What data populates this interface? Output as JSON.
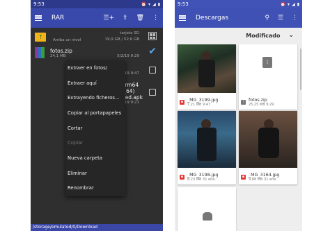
{
  "left": {
    "status_time": "9:53",
    "title": "RAR",
    "parent_row": {
      "label": "Arriba un nivel",
      "storage_label": "tarjeta SD",
      "storage_size": "19,9 GB / 52,6 GB"
    },
    "files": [
      {
        "name": "fotos.zip",
        "size": "24,1 MB",
        "date": "5/2/19 9:29"
      },
      {
        "name": "",
        "size": "",
        "date": "5/2/19 9:47"
      },
      {
        "name": "...52_API17(arm64",
        "size": "",
        "date": ""
      },
      {
        "name": "...a_x86_x86_64)",
        "size": "",
        "date": ""
      },
      {
        "name": "...2.0.6)-vanced.apk",
        "size": "",
        "date": "28/1/19 9:21"
      }
    ],
    "menu": [
      "Extraer en fotos/",
      "Extraer aquí",
      "Extrayendo ficheros...",
      "Copiar al portapapeles",
      "Cortar",
      "Copiar",
      "Nueva carpeta",
      "Eliminar",
      "Renombrar"
    ],
    "path": "/storage/emulated/0/Download"
  },
  "right": {
    "status_time": "9:53",
    "title": "Descargas",
    "sort_label": "Modificado",
    "files": [
      {
        "name": "_MG_3199.jpg",
        "meta": "7,21 MB 9:47"
      },
      {
        "name": "fotos.zip",
        "meta": "25,25 MB 9:29"
      },
      {
        "name": "_MG_3198.jpg",
        "meta": "8,23 MB 31 ene."
      },
      {
        "name": "_MG_3164.jpg",
        "meta": "9,88 MB 31 ene."
      }
    ]
  }
}
